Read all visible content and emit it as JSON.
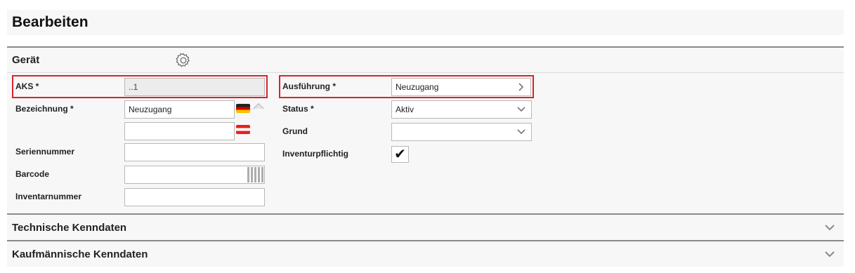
{
  "page": {
    "title": "Bearbeiten"
  },
  "section_geraet": {
    "title": "Gerät",
    "settings_icon": "gear-icon"
  },
  "fields_left": {
    "aks": {
      "label": "AKS *",
      "value": "..1"
    },
    "bezeichnung": {
      "label": "Bezeichnung *",
      "value": "Neuzugang",
      "flag_icon": "flag-de-icon",
      "translate_icon": "translate-icon"
    },
    "bezeichnung_alt": {
      "value": "",
      "flag_icon": "flag-at-icon"
    },
    "seriennummer": {
      "label": "Seriennummer",
      "value": ""
    },
    "barcode": {
      "label": "Barcode",
      "value": "",
      "icon": "qr-code-icon"
    },
    "inventarnummer": {
      "label": "Inventarnummer",
      "value": ""
    }
  },
  "fields_right": {
    "ausfuehrung": {
      "label": "Ausführung *",
      "value": "Neuzugang",
      "icon": "chevron-right-icon"
    },
    "status": {
      "label": "Status *",
      "value": "Aktiv",
      "icon": "chevron-down-icon"
    },
    "grund": {
      "label": "Grund",
      "value": "",
      "icon": "chevron-down-icon"
    },
    "inventurpflichtig": {
      "label": "Inventurpflichtig",
      "checked": true,
      "check_glyph": "✔"
    }
  },
  "section_technisch": {
    "title": "Technische Kenndaten",
    "icon": "chevron-down-icon"
  },
  "section_kaufmaennisch": {
    "title": "Kaufmännische Kenndaten",
    "icon": "chevron-down-icon"
  },
  "colors": {
    "highlight": "#d9232d",
    "section_bg": "#f7f7f7",
    "divider": "#8a8a8a"
  }
}
